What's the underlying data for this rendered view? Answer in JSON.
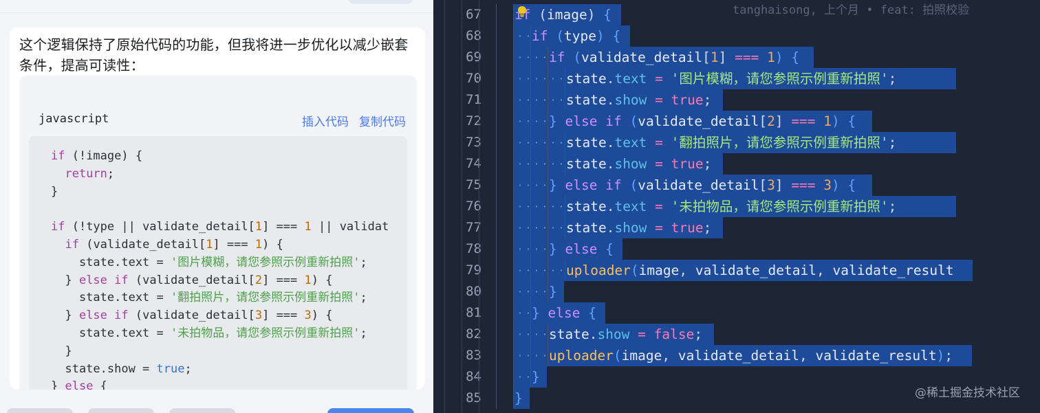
{
  "chat": {
    "message_text": "这个逻辑保持了原始代码的功能，但我将进一步优化以减少嵌套条件，提高可读性：",
    "code_language": "javascript",
    "insert_code_label": "插入代码",
    "copy_code_label": "复制代码",
    "code_lines": [
      [
        [
          "kw",
          "if"
        ],
        [
          "t",
          " (!image) {"
        ]
      ],
      [
        [
          "t",
          "  "
        ],
        [
          "kw",
          "return"
        ],
        [
          "t",
          ";"
        ]
      ],
      [
        [
          "t",
          "}"
        ]
      ],
      [
        [
          "t",
          ""
        ]
      ],
      [
        [
          "kw",
          "if"
        ],
        [
          "t",
          " (!type || validate_detail["
        ],
        [
          "num",
          "1"
        ],
        [
          "t",
          "] === "
        ],
        [
          "num",
          "1"
        ],
        [
          "t",
          " || validat"
        ]
      ],
      [
        [
          "t",
          "  "
        ],
        [
          "kw",
          "if"
        ],
        [
          "t",
          " (validate_detail["
        ],
        [
          "num",
          "1"
        ],
        [
          "t",
          "] === "
        ],
        [
          "num",
          "1"
        ],
        [
          "t",
          ") {"
        ]
      ],
      [
        [
          "t",
          "    state.text = "
        ],
        [
          "str",
          "'图片模糊，请您参照示例重新拍照'"
        ],
        [
          "t",
          ";"
        ]
      ],
      [
        [
          "t",
          "  } "
        ],
        [
          "kw",
          "else if"
        ],
        [
          "t",
          " (validate_detail["
        ],
        [
          "num",
          "2"
        ],
        [
          "t",
          "] === "
        ],
        [
          "num",
          "1"
        ],
        [
          "t",
          ") {"
        ]
      ],
      [
        [
          "t",
          "    state.text = "
        ],
        [
          "str",
          "'翻拍照片，请您参照示例重新拍照'"
        ],
        [
          "t",
          ";"
        ]
      ],
      [
        [
          "t",
          "  } "
        ],
        [
          "kw",
          "else if"
        ],
        [
          "t",
          " (validate_detail["
        ],
        [
          "num",
          "3"
        ],
        [
          "t",
          "] === "
        ],
        [
          "num",
          "3"
        ],
        [
          "t",
          ") {"
        ]
      ],
      [
        [
          "t",
          "    state.text = "
        ],
        [
          "str",
          "'未拍物品，请您参照示例重新拍照'"
        ],
        [
          "t",
          ";"
        ]
      ],
      [
        [
          "t",
          "  }"
        ]
      ],
      [
        [
          "t",
          "  state.show = "
        ],
        [
          "lit",
          "true"
        ],
        [
          "t",
          ";"
        ]
      ],
      [
        [
          "t",
          "} "
        ],
        [
          "kw",
          "else"
        ],
        [
          "t",
          " {"
        ]
      ]
    ]
  },
  "editor": {
    "lightbulb_icon": "lightbulb-icon",
    "blame_annotation": "tanghaisong, 上个月 • feat: 拍照校验",
    "lines": [
      {
        "num": "67",
        "depth": 4,
        "tokens": [
          [
            "kw",
            "if"
          ],
          [
            "pn",
            " "
          ],
          [
            "pn",
            "("
          ],
          [
            "id",
            "image"
          ],
          [
            "pn",
            ")"
          ],
          [
            "pn",
            " "
          ],
          [
            "br",
            "{"
          ]
        ]
      },
      {
        "num": "68",
        "depth": 5,
        "tokens": [
          [
            "kw",
            "if"
          ],
          [
            "pn",
            " "
          ],
          [
            "br",
            "("
          ],
          [
            "id",
            "type"
          ],
          [
            "br",
            ")"
          ],
          [
            "pn",
            " "
          ],
          [
            "br",
            "{"
          ]
        ]
      },
      {
        "num": "69",
        "depth": 6,
        "tokens": [
          [
            "kw",
            "if"
          ],
          [
            "pn",
            " "
          ],
          [
            "br",
            "("
          ],
          [
            "id",
            "validate_detail"
          ],
          [
            "pn",
            "["
          ],
          [
            "num",
            "1"
          ],
          [
            "pn",
            "]"
          ],
          [
            "pn",
            " "
          ],
          [
            "op",
            "==="
          ],
          [
            "pn",
            " "
          ],
          [
            "num",
            "1"
          ],
          [
            "br",
            ")"
          ],
          [
            "pn",
            " "
          ],
          [
            "br",
            "{"
          ]
        ]
      },
      {
        "num": "70",
        "depth": 7,
        "tokens": [
          [
            "id",
            "state"
          ],
          [
            "pn",
            "."
          ],
          [
            "prop",
            "text"
          ],
          [
            "pn",
            " "
          ],
          [
            "op",
            "="
          ],
          [
            "pn",
            " "
          ],
          [
            "str",
            "'图片模糊，请您参照示例重新拍照'"
          ],
          [
            "pn",
            ";"
          ]
        ]
      },
      {
        "num": "71",
        "depth": 7,
        "tokens": [
          [
            "id",
            "state"
          ],
          [
            "pn",
            "."
          ],
          [
            "prop",
            "show"
          ],
          [
            "pn",
            " "
          ],
          [
            "op",
            "="
          ],
          [
            "pn",
            " "
          ],
          [
            "bool",
            "true"
          ],
          [
            "pn",
            ";"
          ]
        ]
      },
      {
        "num": "72",
        "depth": 6,
        "tokens": [
          [
            "br",
            "}"
          ],
          [
            "pn",
            " "
          ],
          [
            "kw",
            "else"
          ],
          [
            "pn",
            " "
          ],
          [
            "kw",
            "if"
          ],
          [
            "pn",
            " "
          ],
          [
            "br",
            "("
          ],
          [
            "id",
            "validate_detail"
          ],
          [
            "pn",
            "["
          ],
          [
            "num",
            "2"
          ],
          [
            "pn",
            "]"
          ],
          [
            "pn",
            " "
          ],
          [
            "op",
            "==="
          ],
          [
            "pn",
            " "
          ],
          [
            "num",
            "1"
          ],
          [
            "br",
            ")"
          ],
          [
            "pn",
            " "
          ],
          [
            "br",
            "{"
          ]
        ]
      },
      {
        "num": "73",
        "depth": 7,
        "tokens": [
          [
            "id",
            "state"
          ],
          [
            "pn",
            "."
          ],
          [
            "prop",
            "text"
          ],
          [
            "pn",
            " "
          ],
          [
            "op",
            "="
          ],
          [
            "pn",
            " "
          ],
          [
            "str",
            "'翻拍照片，请您参照示例重新拍照'"
          ],
          [
            "pn",
            ";"
          ]
        ]
      },
      {
        "num": "74",
        "depth": 7,
        "tokens": [
          [
            "id",
            "state"
          ],
          [
            "pn",
            "."
          ],
          [
            "prop",
            "show"
          ],
          [
            "pn",
            " "
          ],
          [
            "op",
            "="
          ],
          [
            "pn",
            " "
          ],
          [
            "bool",
            "true"
          ],
          [
            "pn",
            ";"
          ]
        ]
      },
      {
        "num": "75",
        "depth": 6,
        "tokens": [
          [
            "br",
            "}"
          ],
          [
            "pn",
            " "
          ],
          [
            "kw",
            "else"
          ],
          [
            "pn",
            " "
          ],
          [
            "kw",
            "if"
          ],
          [
            "pn",
            " "
          ],
          [
            "br",
            "("
          ],
          [
            "id",
            "validate_detail"
          ],
          [
            "pn",
            "["
          ],
          [
            "num",
            "3"
          ],
          [
            "pn",
            "]"
          ],
          [
            "pn",
            " "
          ],
          [
            "op",
            "==="
          ],
          [
            "pn",
            " "
          ],
          [
            "num",
            "3"
          ],
          [
            "br",
            ")"
          ],
          [
            "pn",
            " "
          ],
          [
            "br",
            "{"
          ]
        ]
      },
      {
        "num": "76",
        "depth": 7,
        "tokens": [
          [
            "id",
            "state"
          ],
          [
            "pn",
            "."
          ],
          [
            "prop",
            "text"
          ],
          [
            "pn",
            " "
          ],
          [
            "op",
            "="
          ],
          [
            "pn",
            " "
          ],
          [
            "str",
            "'未拍物品，请您参照示例重新拍照'"
          ],
          [
            "pn",
            ";"
          ]
        ]
      },
      {
        "num": "77",
        "depth": 7,
        "tokens": [
          [
            "id",
            "state"
          ],
          [
            "pn",
            "."
          ],
          [
            "prop",
            "show"
          ],
          [
            "pn",
            " "
          ],
          [
            "op",
            "="
          ],
          [
            "pn",
            " "
          ],
          [
            "bool",
            "true"
          ],
          [
            "pn",
            ";"
          ]
        ]
      },
      {
        "num": "78",
        "depth": 6,
        "tokens": [
          [
            "br",
            "}"
          ],
          [
            "pn",
            " "
          ],
          [
            "kw",
            "else"
          ],
          [
            "pn",
            " "
          ],
          [
            "br",
            "{"
          ]
        ]
      },
      {
        "num": "79",
        "depth": 7,
        "tokens": [
          [
            "fn",
            "uploader"
          ],
          [
            "br",
            "("
          ],
          [
            "id",
            "image"
          ],
          [
            "pn",
            ","
          ],
          [
            "pn",
            " "
          ],
          [
            "id",
            "validate_detail"
          ],
          [
            "pn",
            ","
          ],
          [
            "pn",
            " "
          ],
          [
            "id",
            "validate_result"
          ]
        ]
      },
      {
        "num": "80",
        "depth": 6,
        "tokens": [
          [
            "br",
            "}"
          ]
        ]
      },
      {
        "num": "81",
        "depth": 5,
        "tokens": [
          [
            "br",
            "}"
          ],
          [
            "pn",
            " "
          ],
          [
            "kw",
            "else"
          ],
          [
            "pn",
            " "
          ],
          [
            "br",
            "{"
          ]
        ]
      },
      {
        "num": "82",
        "depth": 6,
        "tokens": [
          [
            "id",
            "state"
          ],
          [
            "pn",
            "."
          ],
          [
            "prop",
            "show"
          ],
          [
            "pn",
            " "
          ],
          [
            "op",
            "="
          ],
          [
            "pn",
            " "
          ],
          [
            "bool",
            "false"
          ],
          [
            "pn",
            ";"
          ]
        ]
      },
      {
        "num": "83",
        "depth": 6,
        "tokens": [
          [
            "fn",
            "uploader"
          ],
          [
            "br",
            "("
          ],
          [
            "id",
            "image"
          ],
          [
            "pn",
            ","
          ],
          [
            "pn",
            " "
          ],
          [
            "id",
            "validate_detail"
          ],
          [
            "pn",
            ","
          ],
          [
            "pn",
            " "
          ],
          [
            "id",
            "validate_result"
          ],
          [
            "br",
            ")"
          ],
          [
            "pn",
            ";"
          ]
        ]
      },
      {
        "num": "84",
        "depth": 5,
        "tokens": [
          [
            "br",
            "}"
          ]
        ]
      },
      {
        "num": "85",
        "depth": 4,
        "tokens": [
          [
            "br",
            "}"
          ]
        ]
      }
    ]
  },
  "watermark": "@稀土掘金技术社区"
}
